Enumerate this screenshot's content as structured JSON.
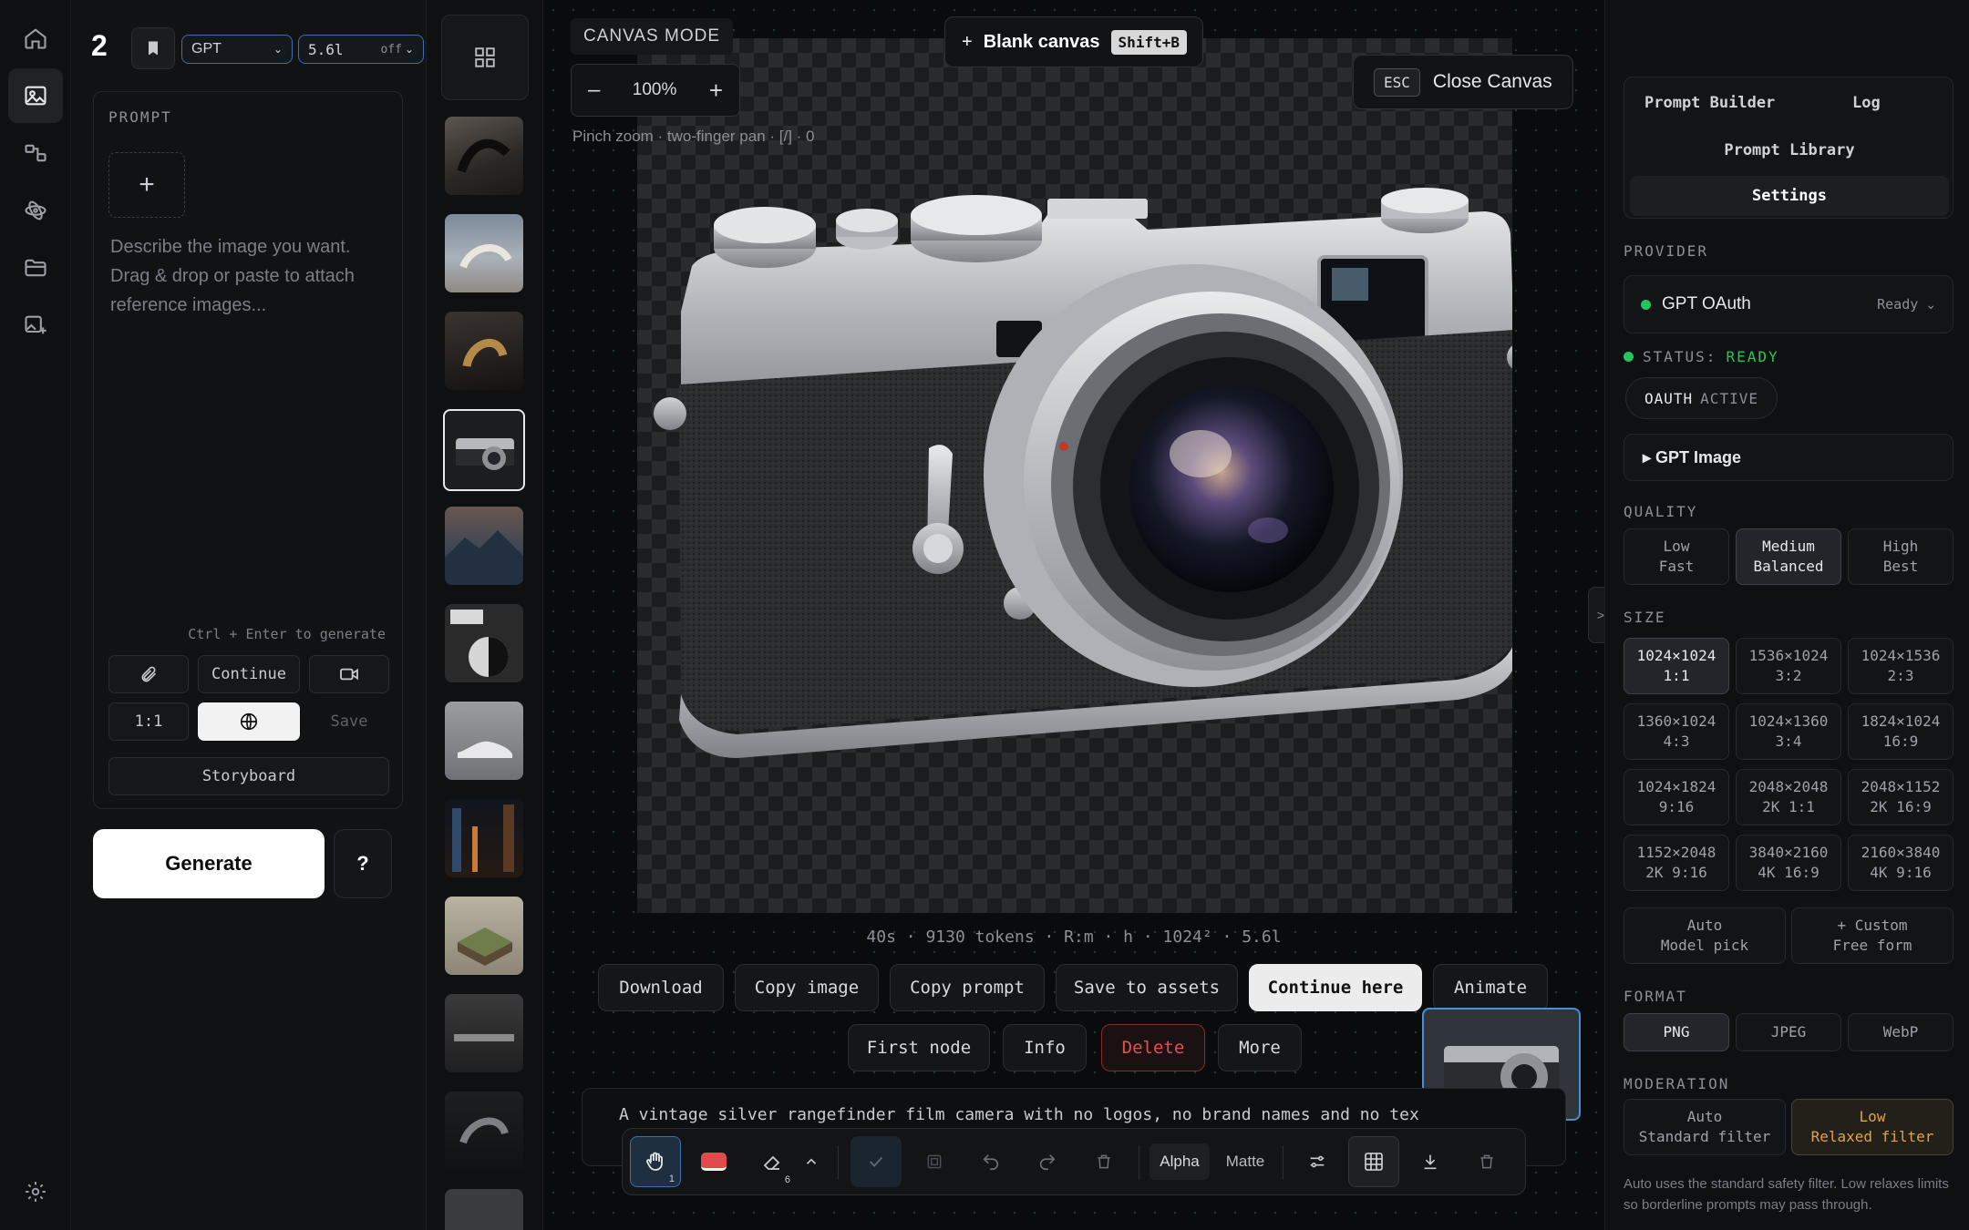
{
  "left": {
    "logo": "2",
    "model": "GPT",
    "version": "5.6l",
    "version_mode": "off",
    "prompt_label": "PROMPT",
    "placeholder": "Describe the image you want. Drag & drop or paste to attach reference images...",
    "shortcut_hint": "Ctrl + Enter to generate",
    "continue_label": "Continue",
    "ratio_label": "1:1",
    "save_label": "Save",
    "storyboard_label": "Storyboard",
    "generate_label": "Generate",
    "help_label": "?"
  },
  "canvas": {
    "mode_label": "CANVAS MODE",
    "blank_label": "Blank canvas",
    "blank_shortcut": "Shift+B",
    "esc_key": "ESC",
    "close_label": "Close Canvas",
    "zoom": "100%",
    "hint": "Pinch zoom · two-finger pan · [/] · 0",
    "meta": "40s · 9130 tokens · R:m · h · 1024² · 5.6l",
    "actions_row1": [
      "Download",
      "Copy image",
      "Copy prompt",
      "Save to assets",
      "Continue here",
      "Animate"
    ],
    "actions_row2": [
      "First node",
      "Info",
      "Delete",
      "More"
    ],
    "prompt_text": "A vintage silver rangefinder film camera with no logos, no brand names and no tex",
    "toolbar": {
      "pan_badge": "1",
      "eraser_badge": "6",
      "alpha": "Alpha",
      "matte": "Matte"
    }
  },
  "right": {
    "tabs": {
      "builder": "Prompt Builder",
      "log": "Log",
      "library": "Prompt Library",
      "settings": "Settings"
    },
    "provider_label": "PROVIDER",
    "provider_name": "GPT OAuth",
    "provider_state": "Ready",
    "status_label": "STATUS:",
    "status_value": "READY",
    "oauth_label": "OAUTH",
    "oauth_value": "ACTIVE",
    "image_section": "▸ GPT Image",
    "quality_label": "QUALITY",
    "quality": [
      {
        "a": "Low",
        "b": "Fast"
      },
      {
        "a": "Medium",
        "b": "Balanced"
      },
      {
        "a": "High",
        "b": "Best"
      }
    ],
    "size_label": "SIZE",
    "sizes": [
      {
        "a": "1024×1024",
        "b": "1:1"
      },
      {
        "a": "1536×1024",
        "b": "3:2"
      },
      {
        "a": "1024×1536",
        "b": "2:3"
      },
      {
        "a": "1360×1024",
        "b": "4:3"
      },
      {
        "a": "1024×1360",
        "b": "3:4"
      },
      {
        "a": "1824×1024",
        "b": "16:9"
      },
      {
        "a": "1024×1824",
        "b": "9:16"
      },
      {
        "a": "2048×2048",
        "b": "2K 1:1"
      },
      {
        "a": "2048×1152",
        "b": "2K 16:9"
      },
      {
        "a": "1152×2048",
        "b": "2K 9:16"
      },
      {
        "a": "3840×2160",
        "b": "4K 16:9"
      },
      {
        "a": "2160×3840",
        "b": "4K 9:16"
      }
    ],
    "auto": {
      "a": "Auto",
      "b": "Model pick"
    },
    "custom": {
      "a": "+ Custom",
      "b": "Free form"
    },
    "format_label": "FORMAT",
    "formats": [
      "PNG",
      "JPEG",
      "WebP"
    ],
    "moderation_label": "MODERATION",
    "moderation": [
      {
        "a": "Auto",
        "b": "Standard filter"
      },
      {
        "a": "Low",
        "b": "Relaxed filter"
      }
    ],
    "moderation_note": "Auto uses the standard safety filter. Low relaxes limits so borderline prompts may pass through.",
    "collapse": ">"
  },
  "colors": {
    "accent": "#3a6fb0",
    "ready": "#22c55e",
    "danger": "#e05252",
    "warn": "#e0a24a"
  }
}
